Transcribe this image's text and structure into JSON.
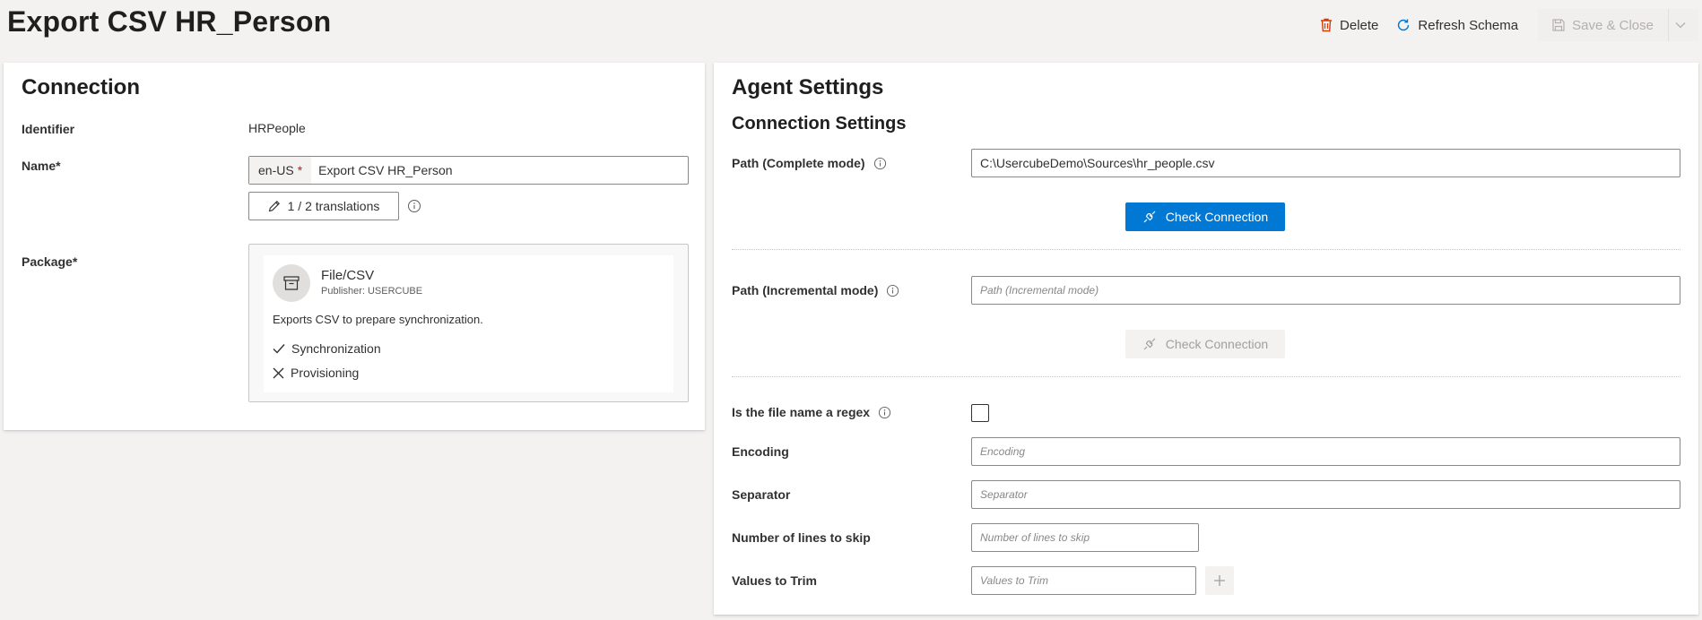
{
  "page": {
    "title": "Export CSV HR_Person"
  },
  "commands": {
    "delete": "Delete",
    "refresh_schema": "Refresh Schema",
    "save_close": "Save & Close"
  },
  "connection": {
    "heading": "Connection",
    "identifier_label": "Identifier",
    "identifier_value": "HRPeople",
    "name_label": "Name*",
    "name_lang": "en-US",
    "name_req_mark": "*",
    "name_value": "Export CSV HR_Person",
    "translations_label": "1 / 2 translations",
    "package_label": "Package*",
    "package": {
      "name": "File/CSV",
      "publisher": "Publisher: USERCUBE",
      "description": "Exports CSV to prepare synchronization.",
      "features": [
        {
          "label": "Synchronization",
          "icon": "checkmark-icon"
        },
        {
          "label": "Provisioning",
          "icon": "cross-icon"
        }
      ]
    }
  },
  "agent": {
    "heading": "Agent Settings",
    "subheading": "Connection Settings",
    "path_complete_label": "Path (Complete mode)",
    "path_complete_value": "C:\\UsercubeDemo\\Sources\\hr_people.csv",
    "check_connection": "Check Connection",
    "path_incremental_label": "Path (Incremental mode)",
    "path_incremental_placeholder": "Path (Incremental mode)",
    "regex_label": "Is the file name a regex",
    "encoding_label": "Encoding",
    "encoding_placeholder": "Encoding",
    "separator_label": "Separator",
    "separator_placeholder": "Separator",
    "lines_skip_label": "Number of lines to skip",
    "lines_skip_placeholder": "Number of lines to skip",
    "trim_label": "Values to Trim",
    "trim_placeholder": "Values to Trim"
  },
  "colors": {
    "primary": "#0078d4",
    "required": "#a4262c",
    "delete_icon": "#d83b01"
  }
}
